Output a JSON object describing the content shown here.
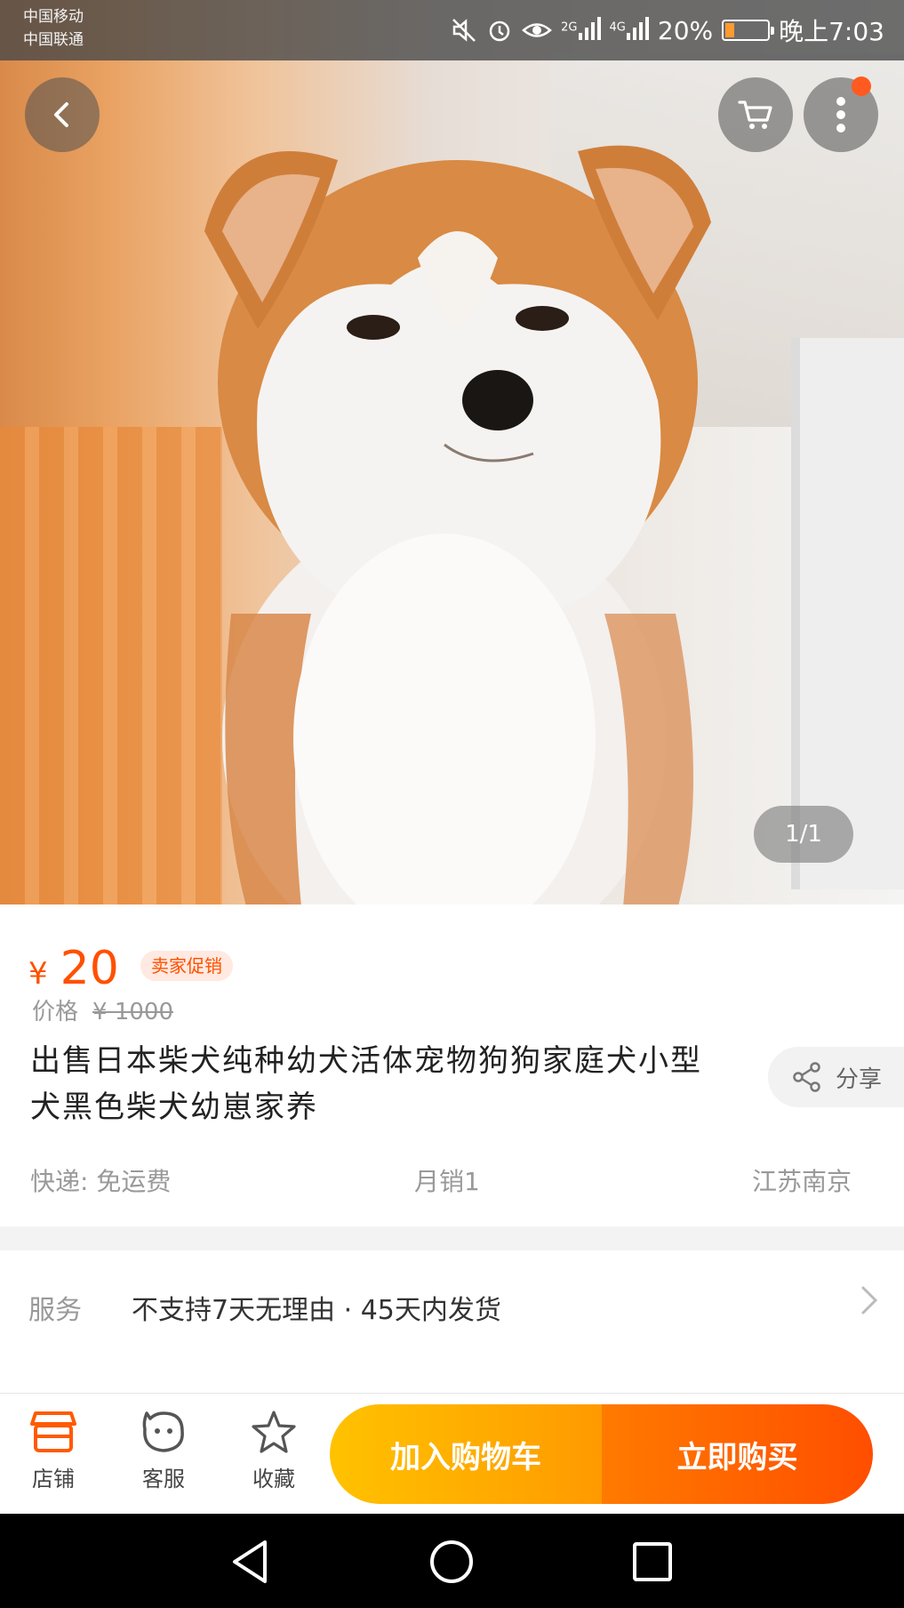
{
  "status": {
    "carrier_line1": "中国移动",
    "carrier_line2": "中国联通",
    "net1": "2G",
    "net2": "4G",
    "battery": "20%",
    "time": "晚上7:03"
  },
  "gallery": {
    "pager": "1/1"
  },
  "product": {
    "price_symbol": "¥",
    "price": "20",
    "promo_badge": "卖家促销",
    "orig_label": "价格",
    "orig_price": "¥ 1000",
    "title": "出售日本柴犬纯种幼犬活体宠物狗狗家庭犬小型犬黑色柴犬幼崽家养",
    "share_label": "分享",
    "shipping": "快递: 免运费",
    "monthly_sales": "月销1",
    "location": "江苏南京"
  },
  "service": {
    "label": "服务",
    "value": "不支持7天无理由 · 45天内发货"
  },
  "actions": {
    "shop": "店铺",
    "support": "客服",
    "favorite": "收藏",
    "add_to_cart": "加入购物车",
    "buy_now": "立即购买"
  },
  "colors": {
    "accent": "#ff5000",
    "cart_btn": "#ffb300",
    "buy_btn": "#ff5a00"
  }
}
